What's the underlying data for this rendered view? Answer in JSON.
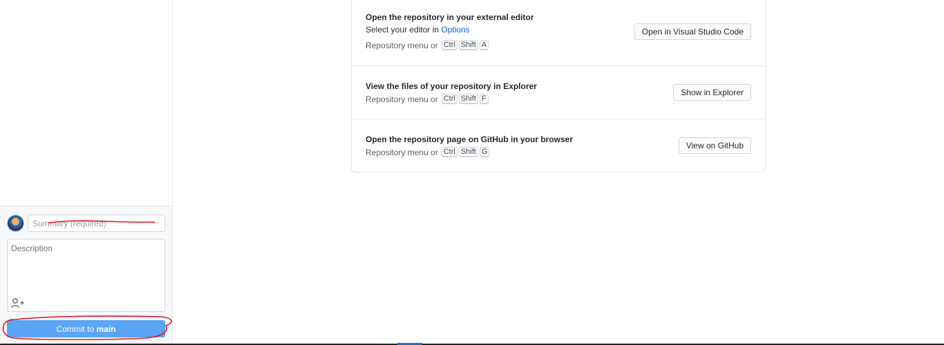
{
  "commit": {
    "summary_placeholder": "Summary (required)",
    "description_placeholder": "Description",
    "button_prefix": "Commit to ",
    "branch": "main",
    "coauthor_icon": "add-coauthor-icon"
  },
  "actions": [
    {
      "title": "Open the repository in your external editor",
      "sub_prefix": "Select your editor in ",
      "sub_link": "Options",
      "shortcut_label": "Repository menu or",
      "keys": [
        "Ctrl",
        "Shift",
        "A"
      ],
      "button": "Open in Visual Studio Code"
    },
    {
      "title": "View the files of your repository in Explorer",
      "shortcut_label": "Repository menu or",
      "keys": [
        "Ctrl",
        "Shift",
        "F"
      ],
      "button": "Show in Explorer"
    },
    {
      "title": "Open the repository page on GitHub in your browser",
      "shortcut_label": "Repository menu or",
      "keys": [
        "Ctrl",
        "Shift",
        "G"
      ],
      "button": "View on GitHub"
    }
  ],
  "colors": {
    "commit_button": "#5aa5f5",
    "link": "#0366d6",
    "annotation": "#e8141b"
  }
}
